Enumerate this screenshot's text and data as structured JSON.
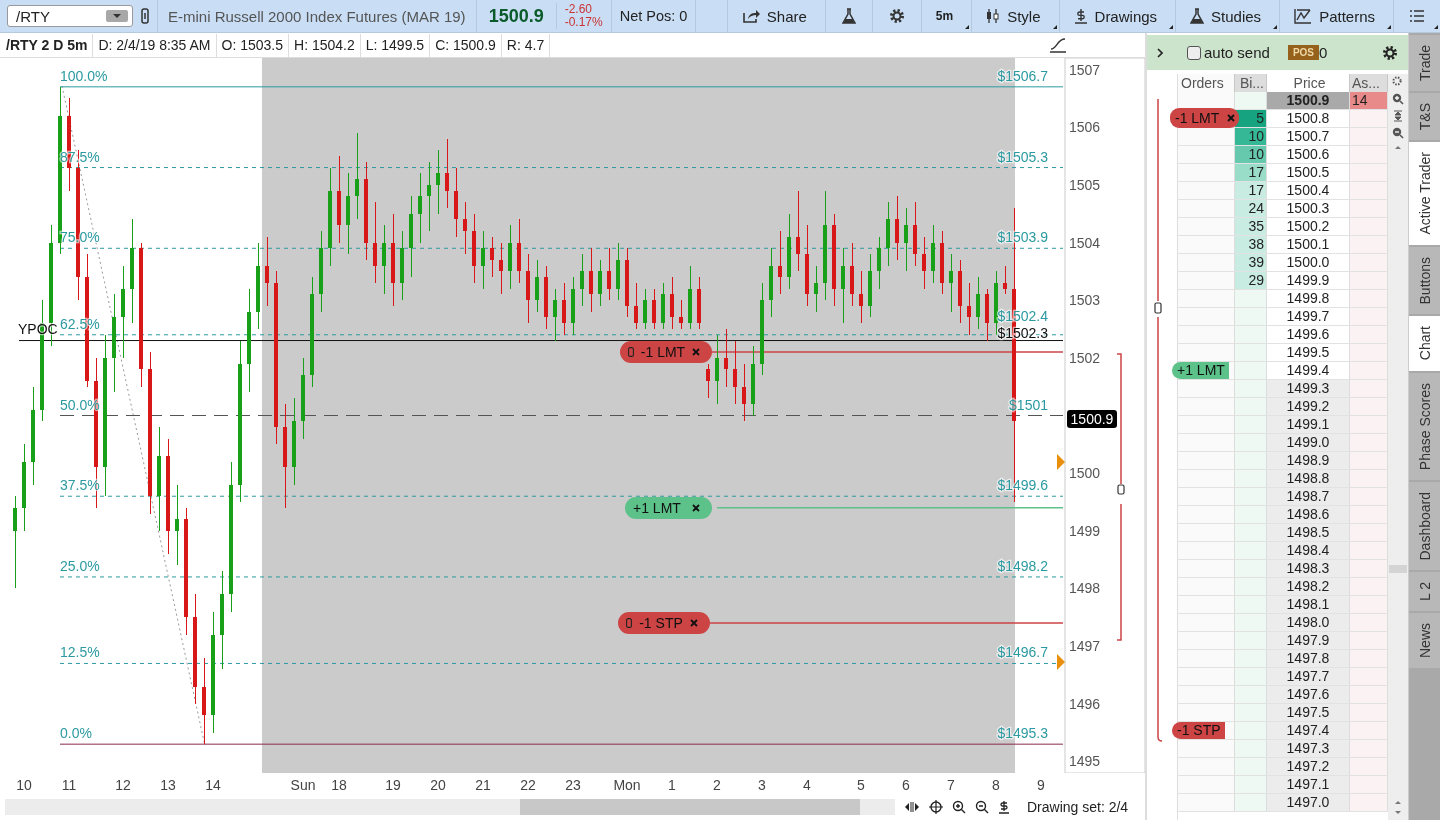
{
  "header": {
    "symbol": "/RTY",
    "description": "E-mini Russell 2000 Index Futures (MAR 19)",
    "last": "1500.9",
    "change": "-2.60",
    "change_pct": "-0.17%",
    "net_pos": "Net Pos: 0",
    "tools": [
      {
        "kind": "share",
        "label": "Share"
      },
      {
        "kind": "flask"
      },
      {
        "kind": "gear"
      },
      {
        "kind": "text",
        "label": "5m"
      },
      {
        "kind": "style",
        "label": "Style"
      },
      {
        "kind": "drawings",
        "label": "Drawings"
      },
      {
        "kind": "flask",
        "label": "Studies"
      },
      {
        "kind": "patterns",
        "label": "Patterns"
      },
      {
        "kind": "menu"
      }
    ]
  },
  "info_bar": [
    "/RTY 2 D 5m",
    "D: 2/4/19 8:35 AM",
    "O: 1503.5",
    "H: 1504.2",
    "L: 1499.5",
    "C: 1500.9",
    "R: 4.7"
  ],
  "chart": {
    "chart_data": {
      "type": "candlestick",
      "categories": [
        null,
        "10",
        null,
        null,
        null,
        null,
        "11",
        null,
        null,
        null,
        null,
        null,
        "12",
        null,
        null,
        null,
        null,
        "13",
        null,
        null,
        null,
        null,
        "14",
        null,
        null,
        null,
        null,
        null,
        null,
        null,
        null,
        null,
        "Sun",
        null,
        null,
        null,
        "18",
        null,
        null,
        null,
        null,
        null,
        "19",
        null,
        null,
        null,
        null,
        "20",
        null,
        null,
        null,
        null,
        "21",
        null,
        null,
        null,
        null,
        "22",
        null,
        null,
        null,
        null,
        "23",
        null,
        null,
        null,
        null,
        null,
        "Mon",
        null,
        null,
        null,
        null,
        "1",
        null,
        null,
        null,
        null,
        "2",
        null,
        null,
        null,
        null,
        "3",
        null,
        null,
        null,
        null,
        "4",
        null,
        null,
        null,
        null,
        null,
        "5",
        null,
        null,
        null,
        null,
        "6",
        null,
        null,
        null,
        null,
        "7",
        null,
        null,
        null,
        null,
        "8",
        null,
        null,
        null,
        null,
        "9",
        null
      ],
      "ohlc": [
        [
          1499.0,
          1499.6,
          1498.0,
          1499.4
        ],
        [
          1499.4,
          1500.5,
          1499.0,
          1500.2
        ],
        [
          1500.2,
          1501.5,
          1499.8,
          1501.1
        ],
        [
          1501.1,
          1503.0,
          1500.9,
          1502.6
        ],
        [
          1502.6,
          1504.3,
          1502.2,
          1504.0
        ],
        [
          1504.0,
          1506.7,
          1503.8,
          1506.2
        ],
        [
          1506.2,
          1506.5,
          1504.9,
          1505.3
        ],
        [
          1505.3,
          1505.6,
          1503.0,
          1503.4
        ],
        [
          1503.4,
          1503.8,
          1501.5,
          1501.6
        ],
        [
          1501.6,
          1502.0,
          1499.4,
          1500.1
        ],
        [
          1500.1,
          1502.4,
          1499.6,
          1502.0
        ],
        [
          1502.0,
          1503.1,
          1501.4,
          1502.7
        ],
        [
          1502.7,
          1503.6,
          1502.0,
          1503.2
        ],
        [
          1503.2,
          1504.4,
          1502.6,
          1503.9
        ],
        [
          1503.9,
          1504.0,
          1501.5,
          1501.8
        ],
        [
          1501.8,
          1502.1,
          1499.3,
          1499.6
        ],
        [
          1499.6,
          1500.8,
          1499.0,
          1500.3
        ],
        [
          1500.3,
          1500.6,
          1498.6,
          1499.0
        ],
        [
          1499.0,
          1499.8,
          1498.4,
          1499.2
        ],
        [
          1499.2,
          1499.4,
          1497.2,
          1497.5
        ],
        [
          1497.5,
          1497.9,
          1496.0,
          1496.3
        ],
        [
          1496.3,
          1496.8,
          1495.3,
          1495.8
        ],
        [
          1495.8,
          1497.6,
          1495.5,
          1497.2
        ],
        [
          1497.2,
          1498.3,
          1496.6,
          1497.9
        ],
        [
          1497.9,
          1500.2,
          1497.6,
          1499.8
        ],
        [
          1499.8,
          1502.3,
          1499.5,
          1501.9
        ],
        [
          1501.9,
          1503.2,
          1501.4,
          1502.8
        ],
        [
          1502.8,
          1504.0,
          1502.5,
          1503.6
        ],
        [
          1503.6,
          1504.1,
          1502.9,
          1503.3
        ],
        [
          1503.3,
          1503.5,
          1500.5,
          1500.8
        ],
        [
          1500.8,
          1501.2,
          1499.4,
          1500.1
        ],
        [
          1500.1,
          1501.3,
          1499.8,
          1500.9
        ],
        [
          1500.9,
          1502.0,
          1500.6,
          1501.7
        ],
        [
          1501.7,
          1503.4,
          1501.5,
          1503.1
        ],
        [
          1503.1,
          1504.2,
          1502.8,
          1503.9
        ],
        [
          1503.9,
          1505.3,
          1503.6,
          1504.9
        ],
        [
          1504.9,
          1505.5,
          1504.0,
          1504.3
        ],
        [
          1504.3,
          1505.2,
          1503.8,
          1504.8
        ],
        [
          1504.8,
          1505.9,
          1504.4,
          1505.1
        ],
        [
          1505.1,
          1505.4,
          1503.7,
          1504.0
        ],
        [
          1504.0,
          1504.7,
          1503.3,
          1503.6
        ],
        [
          1503.6,
          1504.3,
          1503.1,
          1504.0
        ],
        [
          1504.0,
          1504.5,
          1502.9,
          1503.3
        ],
        [
          1503.3,
          1504.2,
          1503.0,
          1503.9
        ],
        [
          1503.9,
          1504.8,
          1503.4,
          1504.5
        ],
        [
          1504.5,
          1505.2,
          1504.0,
          1504.8
        ],
        [
          1504.8,
          1505.4,
          1504.2,
          1505.0
        ],
        [
          1505.0,
          1505.6,
          1504.5,
          1505.2
        ],
        [
          1505.2,
          1505.8,
          1504.6,
          1504.9
        ],
        [
          1504.9,
          1505.3,
          1504.1,
          1504.4
        ],
        [
          1504.4,
          1504.7,
          1503.8,
          1504.2
        ],
        [
          1504.2,
          1504.5,
          1503.3,
          1503.6
        ],
        [
          1503.6,
          1504.2,
          1503.2,
          1503.9
        ],
        [
          1503.9,
          1504.1,
          1503.4,
          1503.7
        ],
        [
          1503.7,
          1504.0,
          1503.1,
          1503.5
        ],
        [
          1503.5,
          1504.3,
          1503.2,
          1504.0
        ],
        [
          1504.0,
          1504.4,
          1503.3,
          1503.5
        ],
        [
          1503.5,
          1503.8,
          1502.6,
          1503.0
        ],
        [
          1503.0,
          1503.7,
          1502.8,
          1503.4
        ],
        [
          1503.4,
          1503.6,
          1502.5,
          1502.7
        ],
        [
          1502.7,
          1503.2,
          1502.3,
          1503.0
        ],
        [
          1503.0,
          1503.3,
          1502.4,
          1502.6
        ],
        [
          1502.6,
          1503.4,
          1502.4,
          1503.2
        ],
        [
          1503.2,
          1503.8,
          1502.9,
          1503.5
        ],
        [
          1503.5,
          1503.9,
          1502.8,
          1503.1
        ],
        [
          1503.1,
          1503.7,
          1502.9,
          1503.5
        ],
        [
          1503.5,
          1503.9,
          1503.0,
          1503.2
        ],
        [
          1503.2,
          1504.0,
          1503.0,
          1503.7
        ],
        [
          1503.7,
          1503.9,
          1502.7,
          1502.9
        ],
        [
          1502.9,
          1503.3,
          1502.5,
          1502.6
        ],
        [
          1502.6,
          1503.2,
          1502.5,
          1503.0
        ],
        [
          1503.0,
          1503.2,
          1502.5,
          1502.6
        ],
        [
          1502.6,
          1503.3,
          1502.5,
          1503.1
        ],
        [
          1503.1,
          1503.4,
          1502.5,
          1502.7
        ],
        [
          1502.7,
          1503.0,
          1502.5,
          1502.6
        ],
        [
          1502.6,
          1503.6,
          1502.5,
          1503.2
        ],
        [
          1503.2,
          1503.4,
          1502.5,
          1502.6
        ],
        [
          1501.8,
          1501.9,
          1501.3,
          1501.6
        ],
        [
          1501.6,
          1502.4,
          1501.2,
          1502.0
        ],
        [
          1502.0,
          1502.5,
          1501.5,
          1501.8
        ],
        [
          1501.8,
          1502.3,
          1501.2,
          1501.5
        ],
        [
          1501.5,
          1501.9,
          1500.9,
          1501.2
        ],
        [
          1501.2,
          1502.2,
          1501.0,
          1501.9
        ],
        [
          1501.9,
          1503.3,
          1501.7,
          1503.0
        ],
        [
          1503.0,
          1503.9,
          1502.7,
          1503.6
        ],
        [
          1503.6,
          1504.2,
          1503.1,
          1503.4
        ],
        [
          1503.4,
          1504.5,
          1503.2,
          1504.1
        ],
        [
          1504.1,
          1504.9,
          1503.5,
          1503.8
        ],
        [
          1503.8,
          1504.3,
          1502.9,
          1503.1
        ],
        [
          1503.1,
          1503.6,
          1502.8,
          1503.3
        ],
        [
          1503.3,
          1504.9,
          1503.0,
          1504.3
        ],
        [
          1504.3,
          1504.5,
          1502.9,
          1503.2
        ],
        [
          1503.2,
          1503.9,
          1502.6,
          1503.6
        ],
        [
          1503.6,
          1504.0,
          1502.9,
          1503.1
        ],
        [
          1503.1,
          1503.5,
          1502.6,
          1502.9
        ],
        [
          1502.9,
          1503.8,
          1502.7,
          1503.5
        ],
        [
          1503.5,
          1504.1,
          1503.2,
          1503.9
        ],
        [
          1503.9,
          1504.7,
          1503.6,
          1504.4
        ],
        [
          1504.4,
          1504.8,
          1503.7,
          1504.0
        ],
        [
          1504.0,
          1504.6,
          1503.5,
          1504.3
        ],
        [
          1504.3,
          1504.7,
          1503.6,
          1503.8
        ],
        [
          1503.8,
          1504.1,
          1503.2,
          1503.5
        ],
        [
          1503.5,
          1504.3,
          1503.3,
          1504.0
        ],
        [
          1504.0,
          1504.2,
          1503.1,
          1503.3
        ],
        [
          1503.3,
          1503.8,
          1502.8,
          1503.5
        ],
        [
          1503.5,
          1503.7,
          1502.6,
          1502.9
        ],
        [
          1502.9,
          1503.3,
          1502.4,
          1502.7
        ],
        [
          1502.7,
          1503.4,
          1502.5,
          1503.1
        ],
        [
          1503.1,
          1503.2,
          1502.3,
          1502.6
        ],
        [
          1502.6,
          1503.5,
          1502.4,
          1503.3
        ],
        [
          1503.3,
          1503.6,
          1503.1,
          1503.2
        ],
        [
          1503.2,
          1504.6,
          1499.5,
          1500.9
        ],
        null,
        null,
        null,
        null
      ],
      "ylim": [
        1494.8,
        1507.2
      ],
      "yticks": [
        1507,
        1506,
        1505,
        1504,
        1503,
        1502,
        1500,
        1499,
        1498,
        1497,
        1496,
        1495
      ],
      "ref_lines": [
        {
          "axis": "y",
          "value": 1506.7
        },
        {
          "axis": "y",
          "value": 1505.3
        },
        {
          "axis": "y",
          "value": 1503.9
        },
        {
          "axis": "y",
          "value": 1502.4
        },
        {
          "axis": "y",
          "value": 1501
        },
        {
          "axis": "y",
          "value": 1499.6
        },
        {
          "axis": "y",
          "value": 1498.2
        },
        {
          "axis": "y",
          "value": 1496.7
        },
        {
          "axis": "y",
          "value": 1495.3
        },
        {
          "axis": "y",
          "value": 1502.3
        },
        {
          "axis": "y",
          "value": 1502.1
        },
        {
          "axis": "y",
          "value": 1499.4
        },
        {
          "axis": "y",
          "value": 1497.4
        }
      ]
    },
    "fib_levels": [
      {
        "percent": "100.0%",
        "price": "$1506.7",
        "kind": "solid"
      },
      {
        "percent": "87.5%",
        "price": "$1505.3",
        "kind": "dotted"
      },
      {
        "percent": "75.0%",
        "price": "$1503.9",
        "kind": "dotted"
      },
      {
        "percent": "62.5%",
        "price": "$1502.4",
        "kind": "dotted"
      },
      {
        "percent": "50.0%",
        "price": "$1501",
        "kind": "dashed"
      },
      {
        "percent": "37.5%",
        "price": "$1499.6",
        "kind": "dotted"
      },
      {
        "percent": "25.0%",
        "price": "$1498.2",
        "kind": "dotted"
      },
      {
        "percent": "12.5%",
        "price": "$1496.7",
        "kind": "dotted"
      },
      {
        "percent": "0.0%",
        "price": "$1495.3",
        "kind": "solid"
      }
    ],
    "poc": {
      "label": "YPOC",
      "price": "$1502.3"
    },
    "last_price": "1500.9",
    "orders": [
      {
        "label": "-1 LMT",
        "color": "#cc4444",
        "linked": true
      },
      {
        "label": "+1 LMT",
        "color": "#5cc28a",
        "linked": false
      },
      {
        "label": "-1 STP",
        "color": "#cc4444",
        "linked": true
      }
    ]
  },
  "footer": {
    "drawing_set": "Drawing set: 2/4"
  },
  "active_trader": {
    "auto_send": {
      "label": "auto send",
      "checked": false
    },
    "pos_badge": "POS",
    "pos_value": "0",
    "columns": [
      "Orders",
      "Bi...",
      "Price",
      "As..."
    ],
    "rows": [
      {
        "price": "1500.9",
        "current": true,
        "shaded": false,
        "ask": {
          "text": "14",
          "color": "#e88a8a"
        }
      },
      {
        "price": "1500.8",
        "current": false,
        "shaded": false,
        "bid": {
          "text": "5",
          "color": "#16a37f"
        },
        "order": {
          "label": "-1 LMT",
          "color": "#cc4444",
          "closable": true
        }
      },
      {
        "price": "1500.7",
        "current": false,
        "shaded": false,
        "bid": {
          "text": "10",
          "color": "#35b896"
        }
      },
      {
        "price": "1500.6",
        "current": false,
        "shaded": false,
        "bid": {
          "text": "10",
          "color": "#66c9ad"
        }
      },
      {
        "price": "1500.5",
        "current": false,
        "shaded": false,
        "bid": {
          "text": "17",
          "color": "#99dcc8"
        }
      },
      {
        "price": "1500.4",
        "current": false,
        "shaded": false,
        "bid": {
          "text": "17",
          "color": "#c8ebe2"
        }
      },
      {
        "price": "1500.3",
        "current": false,
        "shaded": false,
        "bid": {
          "text": "24",
          "color": "#c8ebe2"
        }
      },
      {
        "price": "1500.2",
        "current": false,
        "shaded": false,
        "bid": {
          "text": "35",
          "color": "#c8ebe2"
        }
      },
      {
        "price": "1500.1",
        "current": false,
        "shaded": false,
        "bid": {
          "text": "38",
          "color": "#c8ebe2"
        }
      },
      {
        "price": "1500.0",
        "current": false,
        "shaded": false,
        "bid": {
          "text": "39",
          "color": "#c8ebe2"
        }
      },
      {
        "price": "1499.9",
        "current": false,
        "shaded": false,
        "bid": {
          "text": "29",
          "color": "#c8ebe2"
        }
      },
      {
        "price": "1499.8",
        "current": false,
        "shaded": false
      },
      {
        "price": "1499.7",
        "current": false,
        "shaded": false
      },
      {
        "price": "1499.6",
        "current": false,
        "shaded": false
      },
      {
        "price": "1499.5",
        "current": false,
        "shaded": false
      },
      {
        "price": "1499.4",
        "current": false,
        "shaded": false,
        "order": {
          "label": "+1 LMT",
          "color": "#5cc28a",
          "closable": false
        }
      },
      {
        "price": "1499.3",
        "current": false,
        "shaded": true
      },
      {
        "price": "1499.2",
        "current": false,
        "shaded": true
      },
      {
        "price": "1499.1",
        "current": false,
        "shaded": true
      },
      {
        "price": "1499.0",
        "current": false,
        "shaded": true
      },
      {
        "price": "1498.9",
        "current": false,
        "shaded": true
      },
      {
        "price": "1498.8",
        "current": false,
        "shaded": true
      },
      {
        "price": "1498.7",
        "current": false,
        "shaded": true
      },
      {
        "price": "1498.6",
        "current": false,
        "shaded": true
      },
      {
        "price": "1498.5",
        "current": false,
        "shaded": true
      },
      {
        "price": "1498.4",
        "current": false,
        "shaded": true
      },
      {
        "price": "1498.3",
        "current": false,
        "shaded": true
      },
      {
        "price": "1498.2",
        "current": false,
        "shaded": true
      },
      {
        "price": "1498.1",
        "current": false,
        "shaded": true
      },
      {
        "price": "1498.0",
        "current": false,
        "shaded": true
      },
      {
        "price": "1497.9",
        "current": false,
        "shaded": true
      },
      {
        "price": "1497.8",
        "current": false,
        "shaded": true
      },
      {
        "price": "1497.7",
        "current": false,
        "shaded": true
      },
      {
        "price": "1497.6",
        "current": false,
        "shaded": true
      },
      {
        "price": "1497.5",
        "current": false,
        "shaded": true
      },
      {
        "price": "1497.4",
        "current": false,
        "shaded": true,
        "order": {
          "label": "-1 STP",
          "color": "#cc4444",
          "closable": false
        }
      },
      {
        "price": "1497.3",
        "current": false,
        "shaded": true
      },
      {
        "price": "1497.2",
        "current": false,
        "shaded": true
      },
      {
        "price": "1497.1",
        "current": false,
        "shaded": true
      },
      {
        "price": "1497.0",
        "current": false,
        "shaded": true
      }
    ]
  },
  "side_tabs": [
    {
      "label": "Trade",
      "selected": false
    },
    {
      "label": "T&S",
      "selected": false
    },
    {
      "label": "Active Trader",
      "selected": true
    },
    {
      "label": "Buttons",
      "selected": false
    },
    {
      "label": "Chart",
      "selected": true
    },
    {
      "label": "Phase Scores",
      "selected": false
    },
    {
      "label": "Dashboard",
      "selected": false
    },
    {
      "label": "L 2",
      "selected": false
    },
    {
      "label": "News",
      "selected": false
    }
  ]
}
